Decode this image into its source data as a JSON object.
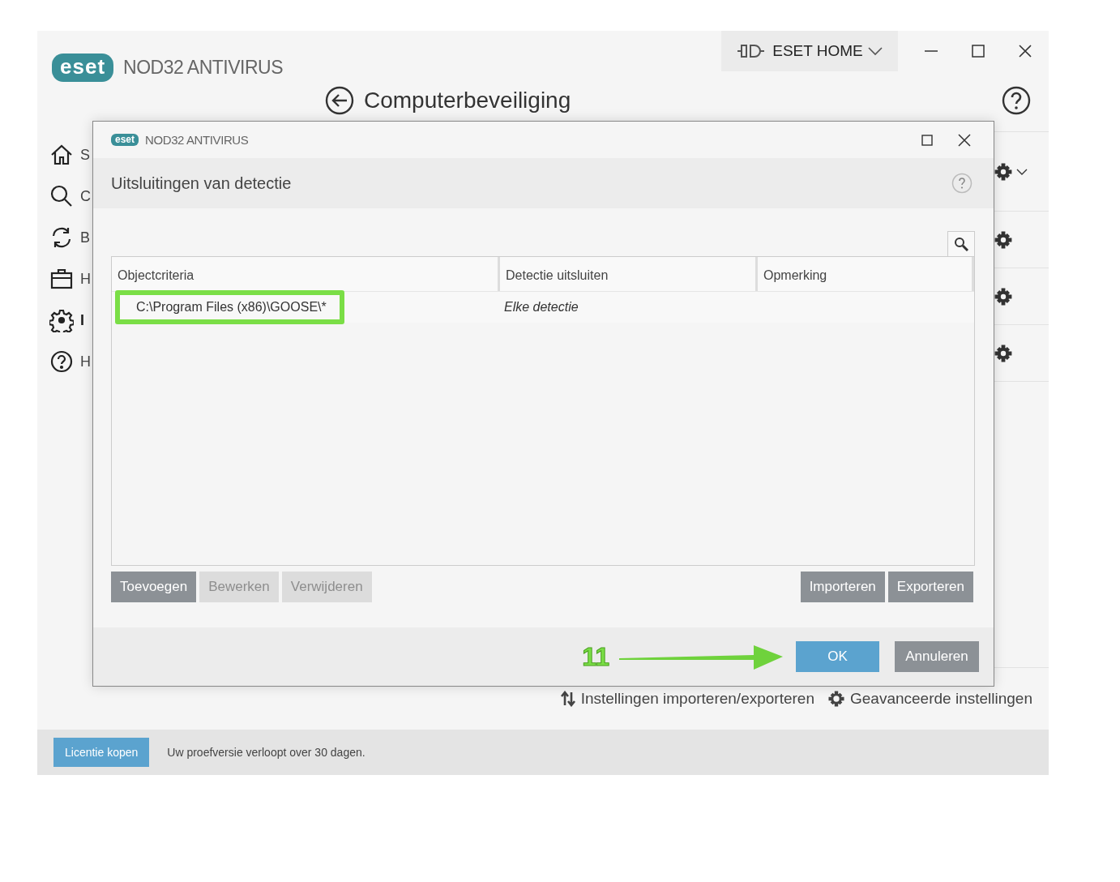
{
  "app": {
    "logo": "eset",
    "product": "NOD32 ANTIVIRUS",
    "home_button": "ESET HOME"
  },
  "page_title": "Computerbeveiliging",
  "sidebar": {
    "items": [
      {
        "label": "S",
        "selected": false
      },
      {
        "label": "C",
        "selected": false
      },
      {
        "label": "B",
        "selected": false
      },
      {
        "label": "H",
        "selected": false
      },
      {
        "label": "I",
        "selected": true
      },
      {
        "label": "H",
        "selected": false
      }
    ]
  },
  "sections": [
    {
      "dropdown": true
    },
    {
      "dropdown": false
    },
    {
      "dropdown": false
    },
    {
      "dropdown": false
    }
  ],
  "bottom_links": [
    {
      "label": "Instellingen importeren/exporteren"
    },
    {
      "label": "Geavanceerde instellingen"
    }
  ],
  "footer": {
    "button": "Licentie kopen",
    "message": "Uw proefversie verloopt over 30 dagen."
  },
  "dialog": {
    "logo": "eset",
    "product": "NOD32 ANTIVIRUS",
    "title": "Uitsluitingen van detectie",
    "table": {
      "columns": [
        "Objectcriteria",
        "Detectie uitsluiten",
        "Opmerking"
      ],
      "rows": [
        {
          "cells": [
            "C:\\Program Files (x86)\\GOOSE\\*",
            "Elke detectie"
          ],
          "highlighted": true
        }
      ]
    },
    "left_buttons": [
      {
        "label": "Toevoegen",
        "disabled": false
      },
      {
        "label": "Bewerken",
        "disabled": true
      },
      {
        "label": "Verwijderen",
        "disabled": true
      }
    ],
    "right_buttons": [
      {
        "label": "Importeren",
        "disabled": false
      },
      {
        "label": "Exporteren",
        "disabled": false
      }
    ],
    "annotation": {
      "number": "11"
    },
    "footer_buttons": [
      {
        "label": "OK",
        "kind": "primary"
      },
      {
        "label": "Annuleren",
        "kind": "secondary"
      }
    ]
  }
}
